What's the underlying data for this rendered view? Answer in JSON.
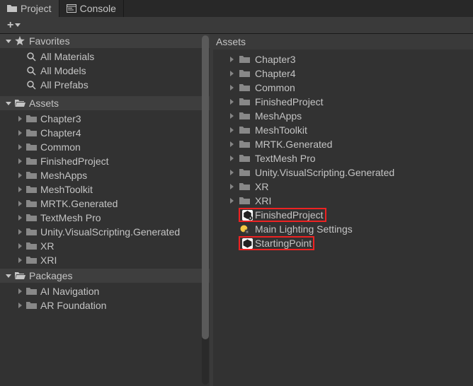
{
  "tabs": {
    "project": "Project",
    "console": "Console"
  },
  "left": {
    "favorites_header": "Favorites",
    "favorites": [
      "All Materials",
      "All Models",
      "All Prefabs"
    ],
    "assets_header": "Assets",
    "assets": [
      "Chapter3",
      "Chapter4",
      "Common",
      "FinishedProject",
      "MeshApps",
      "MeshToolkit",
      "MRTK.Generated",
      "TextMesh Pro",
      "Unity.VisualScripting.Generated",
      "XR",
      "XRI"
    ],
    "packages_header": "Packages",
    "packages": [
      "AI Navigation",
      "AR Foundation"
    ]
  },
  "right": {
    "header": "Assets",
    "folders": [
      "Chapter3",
      "Chapter4",
      "Common",
      "FinishedProject",
      "MeshApps",
      "MeshToolkit",
      "MRTK.Generated",
      "TextMesh Pro",
      "Unity.VisualScripting.Generated",
      "XR",
      "XRI"
    ],
    "scene_finished": "FinishedProject",
    "lighting": "Main Lighting Settings",
    "scene_starting": "StartingPoint"
  }
}
